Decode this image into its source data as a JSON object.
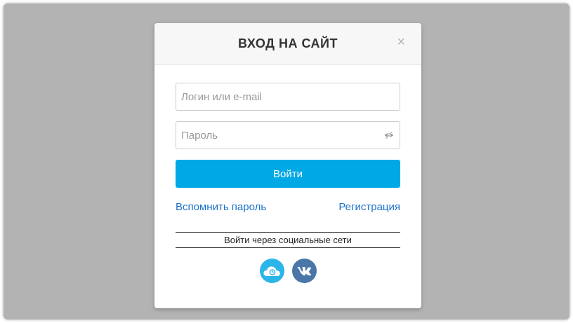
{
  "modal": {
    "title": "ВХОД НА САЙТ",
    "close_label": "×"
  },
  "form": {
    "login": {
      "placeholder": "Логин или e-mail",
      "value": ""
    },
    "password": {
      "placeholder": "Пароль",
      "value": ""
    },
    "submit_label": "Войти"
  },
  "links": {
    "forgot_password": "Вспомнить пароль",
    "register": "Регистрация"
  },
  "social": {
    "title": "Войти через социальные сети",
    "icons": [
      "cloud-icon",
      "vk-icon"
    ]
  },
  "colors": {
    "accent": "#00a8e6",
    "link": "#1a73c8",
    "overlay": "#b3b3b3",
    "vk": "#4a76a8",
    "cloud": "#2cb5e8"
  }
}
